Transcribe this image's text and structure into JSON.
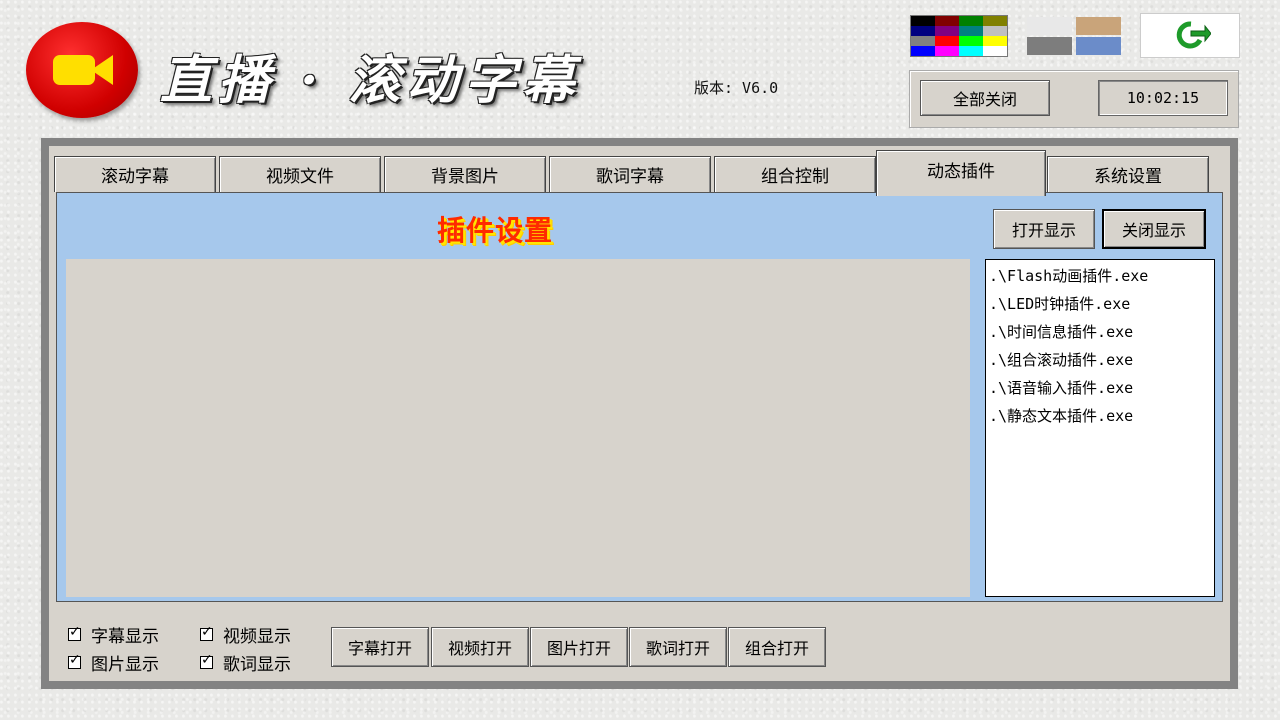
{
  "app": {
    "title": "直播 · 滚动字幕",
    "version": "版本: V6.0"
  },
  "top_right": {
    "close_all_label": "全部关闭",
    "clock": "10:02:15",
    "palette_colors": [
      "#000000",
      "#800000",
      "#008000",
      "#808000",
      "#000080",
      "#800080",
      "#008080",
      "#c0c0c0",
      "#808080",
      "#ff0000",
      "#00ff00",
      "#ffff00",
      "#0000ff",
      "#ff00ff",
      "#00ffff",
      "#ffffff"
    ],
    "textures": [
      "#e8e8e8",
      "#c9a47a",
      "#7d7d7d",
      "#6b8cc9"
    ],
    "exit_icon": "refresh-exit-icon"
  },
  "tabs": [
    {
      "label": "滚动字幕",
      "active": false
    },
    {
      "label": "视频文件",
      "active": false
    },
    {
      "label": "背景图片",
      "active": false
    },
    {
      "label": "歌词字幕",
      "active": false
    },
    {
      "label": "组合控制",
      "active": false
    },
    {
      "label": "动态插件",
      "active": true
    },
    {
      "label": "系统设置",
      "active": false
    }
  ],
  "plugin": {
    "title": "插件设置",
    "open_display_label": "打开显示",
    "close_display_label": "关闭显示",
    "items": [
      ".\\Flash动画插件.exe",
      ".\\LED时钟插件.exe",
      ".\\时间信息插件.exe",
      ".\\组合滚动插件.exe",
      ".\\语音输入插件.exe",
      ".\\静态文本插件.exe"
    ]
  },
  "bottom": {
    "checkboxes": [
      {
        "label": "字幕显示",
        "checked": true
      },
      {
        "label": "视频显示",
        "checked": true
      },
      {
        "label": "图片显示",
        "checked": true
      },
      {
        "label": "歌词显示",
        "checked": true
      }
    ],
    "buttons": [
      "字幕打开",
      "视频打开",
      "图片打开",
      "歌词打开",
      "组合打开"
    ]
  }
}
